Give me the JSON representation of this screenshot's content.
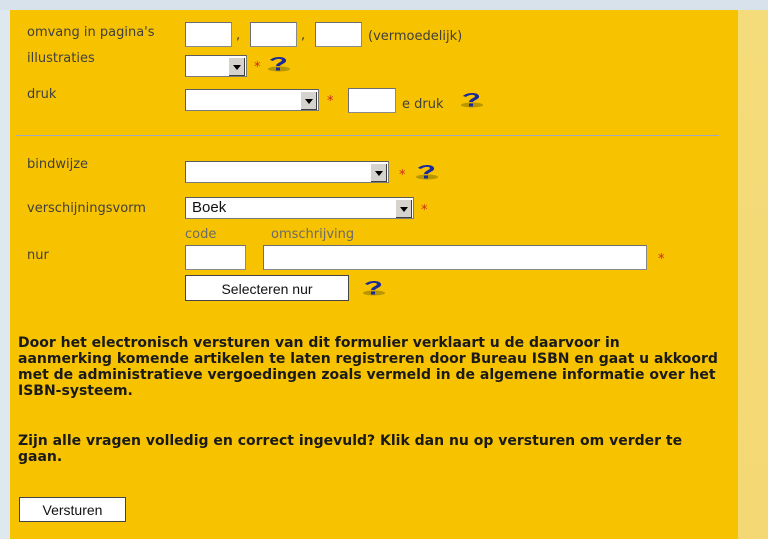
{
  "form": {
    "pages_label": "omvang in pagina's",
    "pages_sep1": ",",
    "pages_sep2": ",",
    "pages_note": "(vermoedelijk)",
    "illustrations_label": "illustraties",
    "edition_label": "druk",
    "edition_suffix": "e druk",
    "binding_label": "bindwijze",
    "appearance_label": "verschijningsvorm",
    "appearance_value": "Boek",
    "nur_code_header": "code",
    "nur_desc_header": "omschrijving",
    "nur_label": "nur",
    "nur_select_button": "Selecteren nur",
    "required_mark": "*",
    "disclaimer": "Door het electronisch versturen van dit formulier verklaart u de daarvoor in aanmerking komende artikelen te laten registreren door Bureau ISBN en gaat u akkoord met de administratieve vergoedingen zoals vermeld in de algemene informatie over het ISBN-systeem.",
    "confirm": "Zijn alle vragen volledig en correct ingevuld? Klik dan nu op versturen om verder te gaan.",
    "submit_button": "Versturen"
  },
  "icons": {
    "help": "question-mark-icon",
    "dropdown": "chevron-down-icon"
  },
  "colors": {
    "panel": "#f7c200",
    "required": "#cc2a1a",
    "help_icon": "#1a2a9a"
  }
}
